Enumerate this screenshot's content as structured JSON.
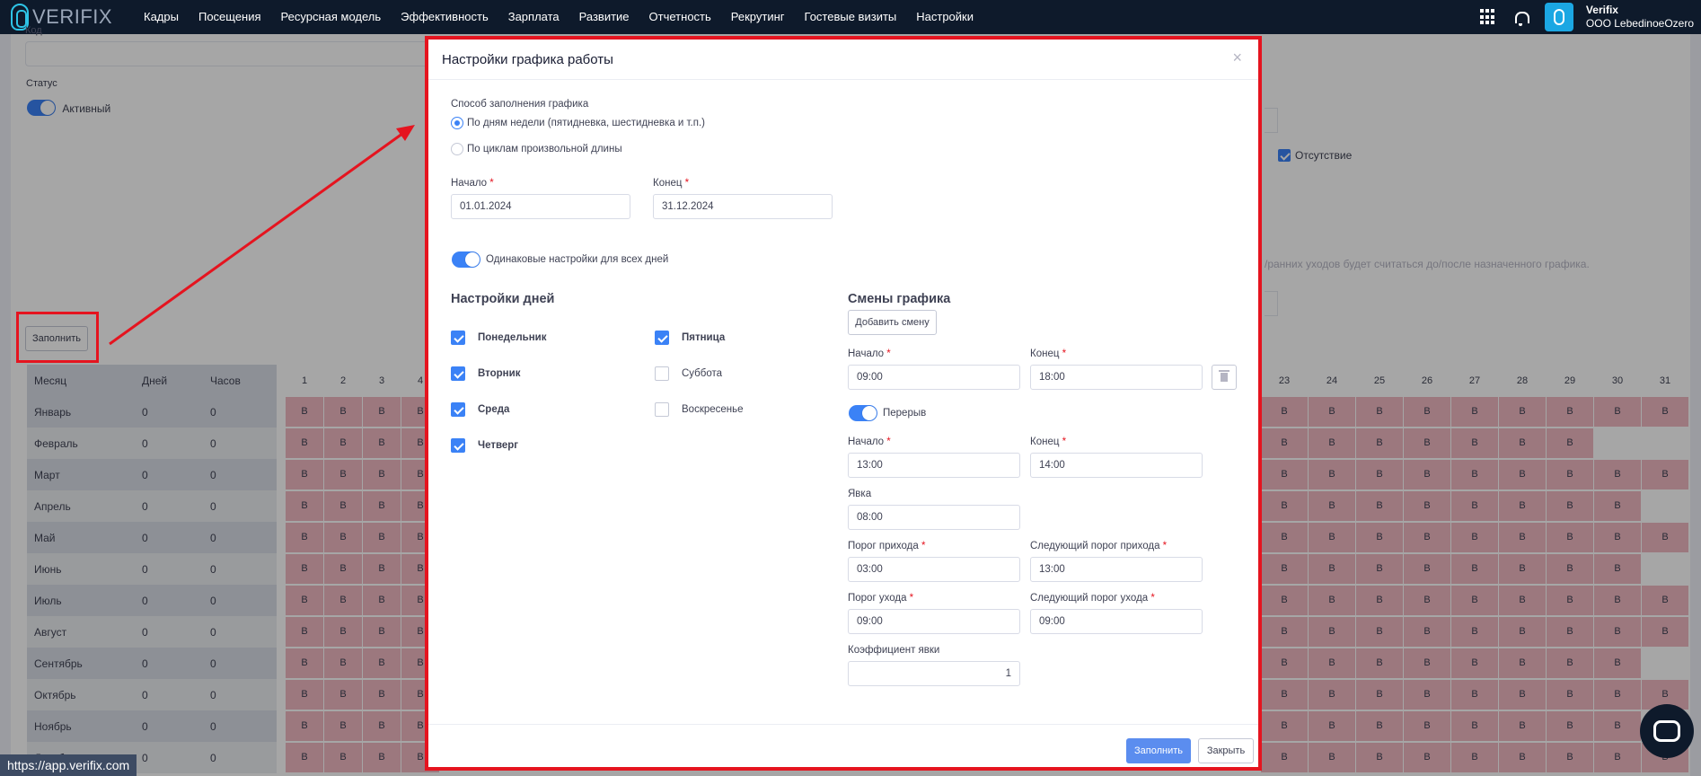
{
  "navbar": {
    "logo_text": "VERIFIX",
    "menu": [
      "Кадры",
      "Посещения",
      "Ресурсная модель",
      "Эффективность",
      "Зарплата",
      "Развитие",
      "Отчетность",
      "Рекрутинг",
      "Гостевые визиты",
      "Настройки"
    ],
    "user_name": "Verifix",
    "user_org": "OOO LebedinoeOzero"
  },
  "background": {
    "field_label_partial": "Код",
    "status_label": "Статус",
    "status_value": "Активный",
    "absence_label": "Отсутствие",
    "hint_text": "/ранних уходов будет считаться до/после назначенного графика.",
    "fill_button": "Заполнить",
    "table": {
      "headers": [
        "Месяц",
        "Дней",
        "Часов"
      ],
      "left_day_headers": [
        "1",
        "2",
        "3",
        "4"
      ],
      "right_day_headers": [
        "23",
        "24",
        "25",
        "26",
        "27",
        "28",
        "29",
        "30",
        "31"
      ],
      "cell_value": "В",
      "rows": [
        {
          "month": "Январь",
          "days": "0",
          "hours": "0",
          "right_count": 9
        },
        {
          "month": "Февраль",
          "days": "0",
          "hours": "0",
          "right_count": 7
        },
        {
          "month": "Март",
          "days": "0",
          "hours": "0",
          "right_count": 9
        },
        {
          "month": "Апрель",
          "days": "0",
          "hours": "0",
          "right_count": 8
        },
        {
          "month": "Май",
          "days": "0",
          "hours": "0",
          "right_count": 9
        },
        {
          "month": "Июнь",
          "days": "0",
          "hours": "0",
          "right_count": 8
        },
        {
          "month": "Июль",
          "days": "0",
          "hours": "0",
          "right_count": 9
        },
        {
          "month": "Август",
          "days": "0",
          "hours": "0",
          "right_count": 9
        },
        {
          "month": "Сентябрь",
          "days": "0",
          "hours": "0",
          "right_count": 8
        },
        {
          "month": "Октябрь",
          "days": "0",
          "hours": "0",
          "right_count": 9
        },
        {
          "month": "Ноябрь",
          "days": "0",
          "hours": "0",
          "right_count": 8
        },
        {
          "month": "Декабрь",
          "days": "0",
          "hours": "0",
          "right_count": 9
        }
      ]
    }
  },
  "modal": {
    "title": "Настройки графика работы",
    "fill_method_label": "Способ заполнения графика",
    "option_week": "По дням недели (пятидневка, шестидневка и т.п.)",
    "option_cycle": "По циклам произвольной длины",
    "start_label": "Начало",
    "end_label": "Конец",
    "start_value": "01.01.2024",
    "end_value": "31.12.2024",
    "same_settings": "Одинаковые настройки для всех дней",
    "days_heading": "Настройки дней",
    "days": [
      {
        "label": "Понедельник",
        "checked": true
      },
      {
        "label": "Вторник",
        "checked": true
      },
      {
        "label": "Среда",
        "checked": true
      },
      {
        "label": "Четверг",
        "checked": true
      },
      {
        "label": "Пятница",
        "checked": true
      },
      {
        "label": "Суббота",
        "checked": false
      },
      {
        "label": "Воскресенье",
        "checked": false
      }
    ],
    "shifts_heading": "Смены графика",
    "add_shift": "Добавить смену",
    "shift_start": "09:00",
    "shift_end": "18:00",
    "break_label": "Перерыв",
    "break_start": "13:00",
    "break_end": "14:00",
    "presence_label": "Явка",
    "presence_value": "08:00",
    "arrival_threshold_label": "Порог прихода",
    "arrival_threshold": "03:00",
    "next_arrival_label": "Следующий порог прихода",
    "next_arrival": "13:00",
    "leave_threshold_label": "Порог ухода",
    "leave_threshold": "09:00",
    "next_leave_label": "Следующий порог ухода",
    "next_leave": "09:00",
    "coef_label": "Коэффициент явки",
    "coef_value": "1",
    "fill_button": "Заполнить",
    "close_button": "Закрыть"
  },
  "status_url": "https://app.verifix.com",
  "colors": {
    "accent": "#3b82f6",
    "annotation": "#e5141f",
    "weekend_cell": "#f0b9c2",
    "nav_bg": "#0e1a2b"
  }
}
